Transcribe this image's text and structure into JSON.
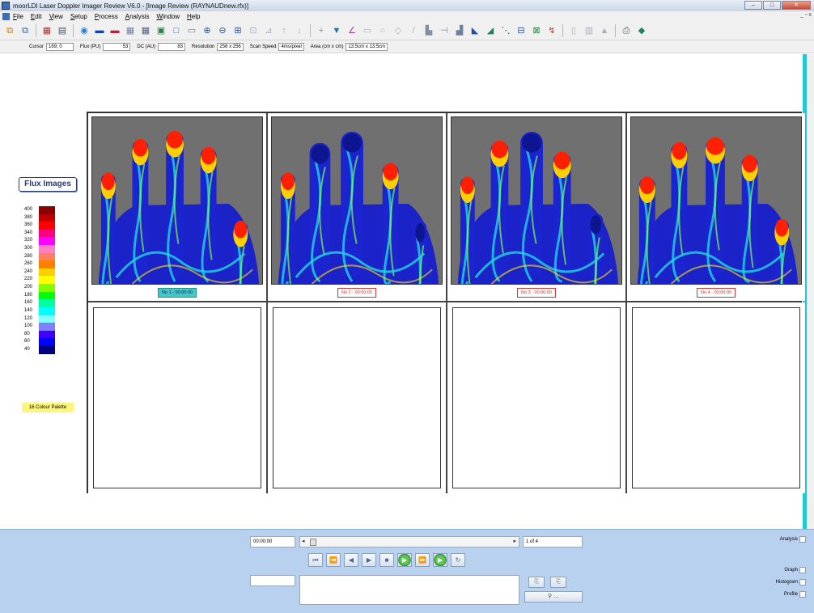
{
  "window": {
    "title": "moorLDI Laser Doppler Imager Review V6.0 - [Image Review (RAYNAUDnew.rfx)]",
    "controls": {
      "minimize": "–",
      "maximize": "□",
      "close": "✕"
    }
  },
  "menu": {
    "items": [
      "File",
      "Edit",
      "View",
      "Setup",
      "Process",
      "Analysis",
      "Window",
      "Help"
    ],
    "mdi_controls": [
      "_",
      "▫",
      "x"
    ]
  },
  "toolbar": {
    "icons": [
      "open-file-icon",
      "copy-icon",
      "print-preview-icon",
      "clipboard-icon",
      "globe-icon",
      "display-image-icon",
      "photo-icon",
      "grid-view-icon",
      "grid-detail-icon",
      "camera-icon",
      "frame-icon",
      "zoom-in-icon",
      "zoom-out-icon",
      "zoom-fit-icon",
      "select-region-icon",
      "region-tool-icon",
      "move-up-icon",
      "move-down-icon",
      "cross-hair-icon",
      "filter-icon",
      "angle-icon",
      "rectangle-icon",
      "circle-icon",
      "polygon-icon",
      "line-icon",
      "bar-chart-icon",
      "profile-icon",
      "histogram-icon",
      "rotate-icon",
      "colour-map-icon",
      "draw-icon",
      "stats-icon",
      "compare-icon",
      "export-icon",
      "columns-icon",
      "chart-icon",
      "printer-icon",
      "help-icon"
    ]
  },
  "status": {
    "cursor_label": "Cursor",
    "cursor_value": "169, 0",
    "flux_label": "Flux (PU)",
    "flux_value": "53",
    "dc_label": "DC (AU)",
    "dc_value": "83",
    "resolution_label": "Resolution",
    "resolution_value": "256 x 256",
    "scan_speed_label": "Scan Speed",
    "scan_speed_value": "4ms/pixel",
    "area_label": "Area (cm x cm)",
    "area_value": "13.5cm x 13.5cm"
  },
  "sidebar": {
    "flux_images_label": "Flux Images",
    "palette_name": "16 Colour Palette",
    "palette": [
      {
        "label": "400",
        "color": "#8b0000"
      },
      {
        "label": "380",
        "color": "#c00000"
      },
      {
        "label": "360",
        "color": "#ff0000"
      },
      {
        "label": "340",
        "color": "#ff0080"
      },
      {
        "label": "320",
        "color": "#ff00ff"
      },
      {
        "label": "300",
        "color": "#ff80c0"
      },
      {
        "label": "280",
        "color": "#ff8060"
      },
      {
        "label": "260",
        "color": "#ff8000"
      },
      {
        "label": "240",
        "color": "#ffd000"
      },
      {
        "label": "220",
        "color": "#ffff00"
      },
      {
        "label": "200",
        "color": "#80ff00"
      },
      {
        "label": "180",
        "color": "#00ff00"
      },
      {
        "label": "160",
        "color": "#00ffa0"
      },
      {
        "label": "140",
        "color": "#00ffff"
      },
      {
        "label": "120",
        "color": "#80ffff"
      },
      {
        "label": "100",
        "color": "#8080ff"
      },
      {
        "label": "80",
        "color": "#4000ff"
      },
      {
        "label": "60",
        "color": "#0000ff"
      },
      {
        "label": "40",
        "color": "#000080"
      }
    ]
  },
  "images": [
    {
      "tag": "No 1 - 00:00:00",
      "active": true
    },
    {
      "tag": "No 2 - 00:00:00",
      "active": false
    },
    {
      "tag": "No 3 - 00:00:00",
      "active": false
    },
    {
      "tag": "No 4 - 00:00:00",
      "active": false
    }
  ],
  "playback": {
    "time": "00:00:00",
    "counter": "1 of 4",
    "buttons": [
      "first-frame",
      "rewind",
      "step-back",
      "play",
      "stop",
      "record",
      "fast-forward",
      "record-loop",
      "loop"
    ]
  },
  "find_button": "…",
  "right_panel": {
    "analysis": "Analysis",
    "graph": "Graph",
    "histogram": "Histogram",
    "profile": "Profile"
  }
}
